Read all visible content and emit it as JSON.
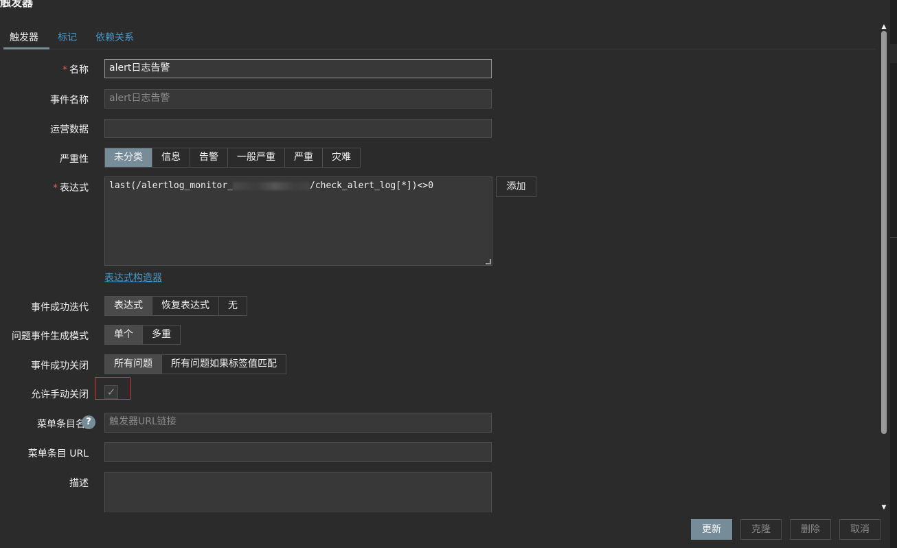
{
  "dialog": {
    "title": "触发器"
  },
  "tabs": [
    {
      "label": "触发器"
    },
    {
      "label": "标记"
    },
    {
      "label": "依赖关系"
    }
  ],
  "form": {
    "name": {
      "label": "名称",
      "value": "alert日志告警"
    },
    "event_name": {
      "label": "事件名称",
      "value": "alert日志告警"
    },
    "opdata": {
      "label": "运营数据",
      "value": ""
    },
    "severity": {
      "label": "严重性",
      "options": [
        "未分类",
        "信息",
        "告警",
        "一般严重",
        "严重",
        "灾难"
      ],
      "selected": "未分类"
    },
    "expression": {
      "label": "表达式",
      "value_prefix": "last(/alertlog_monitor_",
      "value_suffix": "/check_alert_log[*])<>0",
      "add_button": "添加",
      "builder_link": "表达式构造器"
    },
    "ok_event_generation": {
      "label": "事件成功迭代",
      "options": [
        "表达式",
        "恢复表达式",
        "无"
      ],
      "selected": "表达式"
    },
    "problem_mode": {
      "label": "问题事件生成模式",
      "options": [
        "单个",
        "多重"
      ],
      "selected": "单个"
    },
    "ok_event_closes": {
      "label": "事件成功关闭",
      "options": [
        "所有问题",
        "所有问题如果标签值匹配"
      ],
      "selected": "所有问题"
    },
    "manual_close": {
      "label": "允许手动关闭",
      "checked": true,
      "check_glyph": "✓"
    },
    "url_name": {
      "label": "菜单条目名",
      "placeholder": "触发器URL链接",
      "help": "?"
    },
    "url": {
      "label": "菜单条目 URL",
      "value": ""
    },
    "description": {
      "label": "描述",
      "value": ""
    }
  },
  "footer": {
    "update": "更新",
    "clone": "克隆",
    "delete": "删除",
    "cancel": "取消"
  },
  "scrollbar": {
    "up": "▲",
    "down": "▼"
  }
}
